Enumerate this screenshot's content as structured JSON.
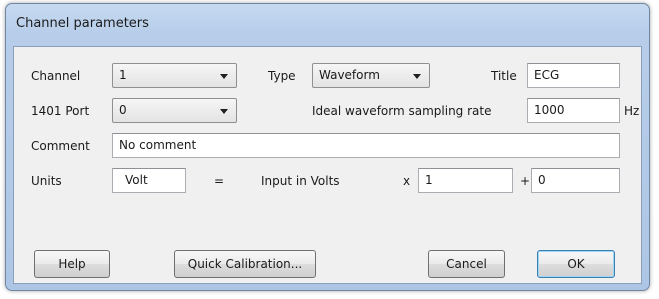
{
  "dialog": {
    "title": "Channel parameters"
  },
  "channel": {
    "label": "Channel",
    "value": "1"
  },
  "type": {
    "label": "Type",
    "value": "Waveform"
  },
  "title_field": {
    "label": "Title",
    "value": "ECG"
  },
  "port": {
    "label": "1401 Port",
    "value": "0"
  },
  "sampling": {
    "label": "Ideal waveform sampling rate",
    "value": "1000",
    "unit": "Hz"
  },
  "comment": {
    "label": "Comment",
    "value": "No comment"
  },
  "units": {
    "label": "Units",
    "value": "Volt",
    "equals": "=",
    "input_label": "Input in Volts",
    "times": "x",
    "scale": "1",
    "plus": "+",
    "offset": "0"
  },
  "buttons": {
    "help": "Help",
    "quick_calibration": "Quick Calibration...",
    "cancel": "Cancel",
    "ok": "OK"
  },
  "icons": {
    "dropdown": "chevron-down-icon"
  }
}
